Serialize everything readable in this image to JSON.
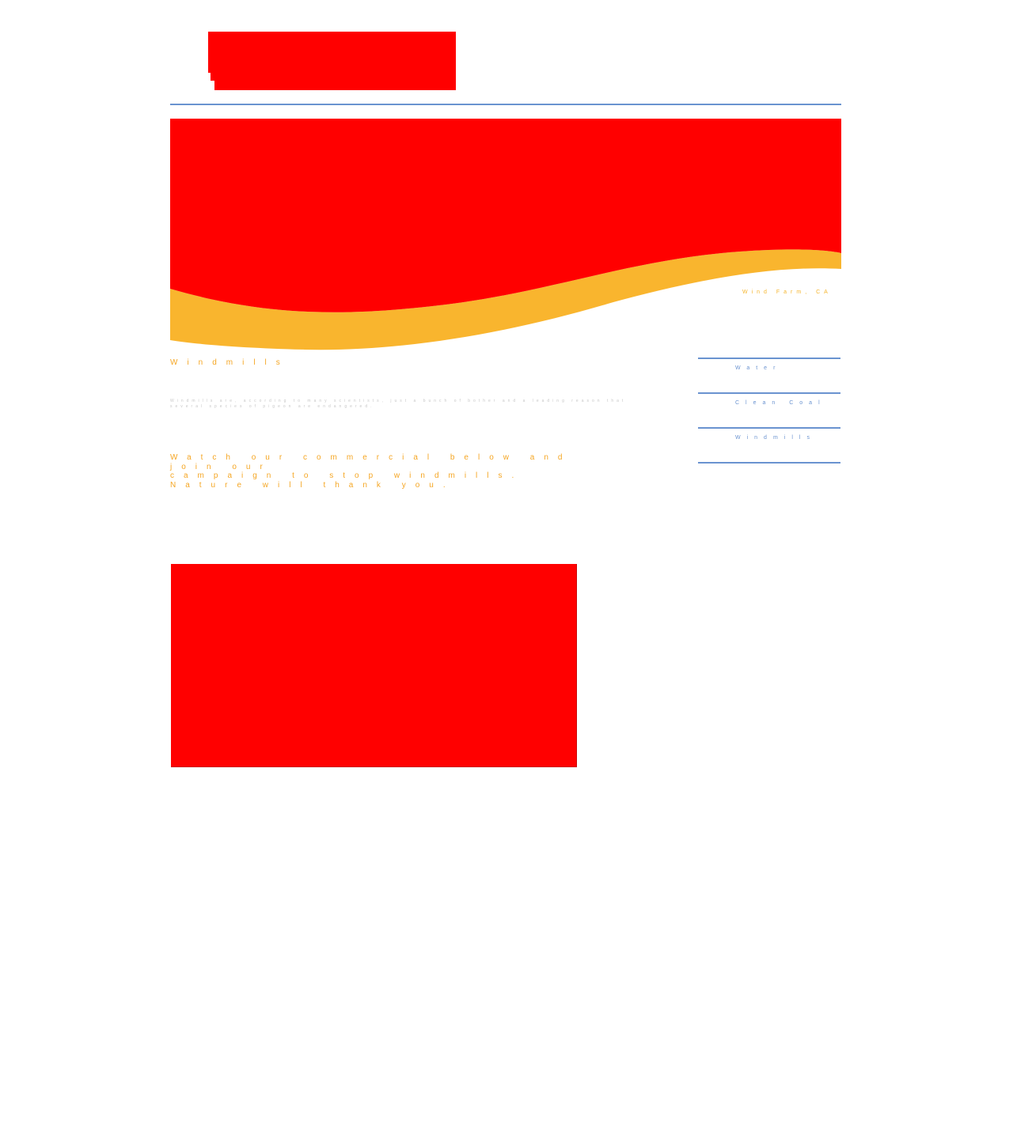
{
  "colors": {
    "placeholder": "#ff0000",
    "wave": "#f9b52e",
    "accent_text": "#f5a623",
    "rule": "#6a93d0",
    "body_text": "#c8c8c8"
  },
  "header": {
    "logo_image": "missing-image-placeholder"
  },
  "banner": {
    "image": "missing-image-placeholder",
    "caption": "Wind Farm, CA"
  },
  "main": {
    "title": "Windmills",
    "body": "Windmills are, according to many scientists, just a bunch of bother and a leading reason that several species of pigeon are endangered.",
    "cta_lines": [
      "Watch our commercial below and join our",
      "campaign to stop windmills.",
      "Nature will thank you."
    ],
    "video": "missing-video-placeholder"
  },
  "sidebar": {
    "items": [
      {
        "label": "Water"
      },
      {
        "label": "Clean Coal"
      },
      {
        "label": "Windmills"
      }
    ]
  }
}
